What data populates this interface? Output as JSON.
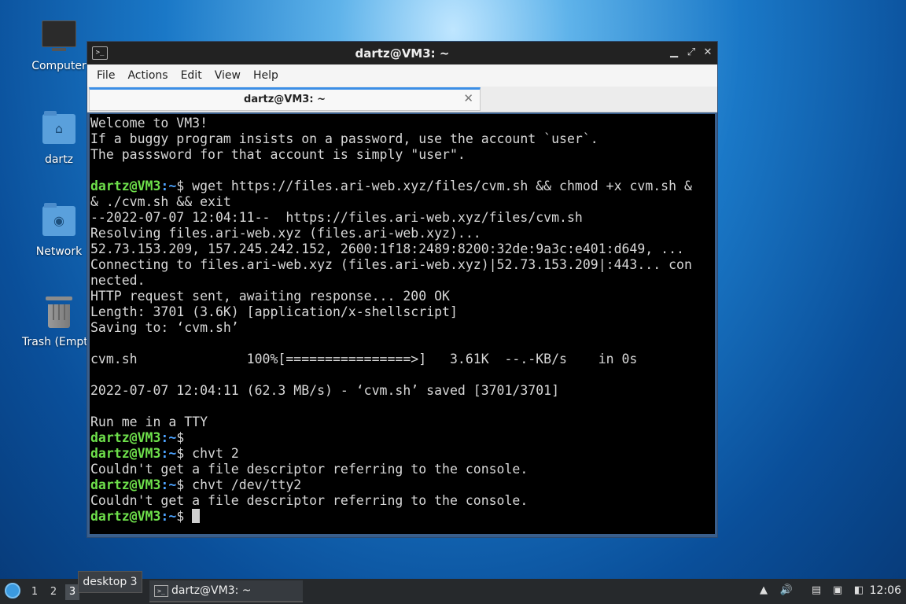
{
  "desktop": {
    "icons": [
      {
        "label": "Computer",
        "icon": "computer-icon"
      },
      {
        "label": "dartz",
        "icon": "home-folder-icon"
      },
      {
        "label": "Network",
        "icon": "network-folder-icon"
      },
      {
        "label": "Trash (Empt",
        "icon": "trash-icon"
      }
    ]
  },
  "window": {
    "title": "dartz@VM3: ~",
    "menu": [
      "File",
      "Actions",
      "Edit",
      "View",
      "Help"
    ],
    "tab_label": "dartz@VM3: ~",
    "tab_close": "✕"
  },
  "terminal": {
    "prompt_user": "dartz@VM3",
    "prompt_path": ":~",
    "prompt_end": "$ ",
    "lines": [
      "Welcome to VM3!",
      "If a buggy program insists on a password, use the account `user`.",
      "The passsword for that account is simply \"user\".",
      "",
      "wget https://files.ari-web.xyz/files/cvm.sh && chmod +x cvm.sh &",
      "& ./cvm.sh && exit",
      "--2022-07-07 12:04:11--  https://files.ari-web.xyz/files/cvm.sh",
      "Resolving files.ari-web.xyz (files.ari-web.xyz)...",
      "52.73.153.209, 157.245.242.152, 2600:1f18:2489:8200:32de:9a3c:e401:d649, ...",
      "Connecting to files.ari-web.xyz (files.ari-web.xyz)|52.73.153.209|:443... con",
      "nected.",
      "HTTP request sent, awaiting response... 200 OK",
      "Length: 3701 (3.6K) [application/x-shellscript]",
      "Saving to: ‘cvm.sh’",
      "",
      "cvm.sh              100%[================>]   3.61K  --.-KB/s    in 0s",
      "",
      "2022-07-07 12:04:11 (62.3 MB/s) - ‘cvm.sh’ saved [3701/3701]",
      "",
      "Run me in a TTY",
      "",
      "chvt 2",
      "Couldn't get a file descriptor referring to the console.",
      "chvt /dev/tty2",
      "Couldn't get a file descriptor referring to the console.",
      ""
    ]
  },
  "taskbar": {
    "workspaces": [
      "1",
      "2",
      "3"
    ],
    "active_workspace": "3",
    "task_label": "dartz@VM3: ~",
    "tooltip": "desktop 3",
    "clock": "12:06"
  }
}
